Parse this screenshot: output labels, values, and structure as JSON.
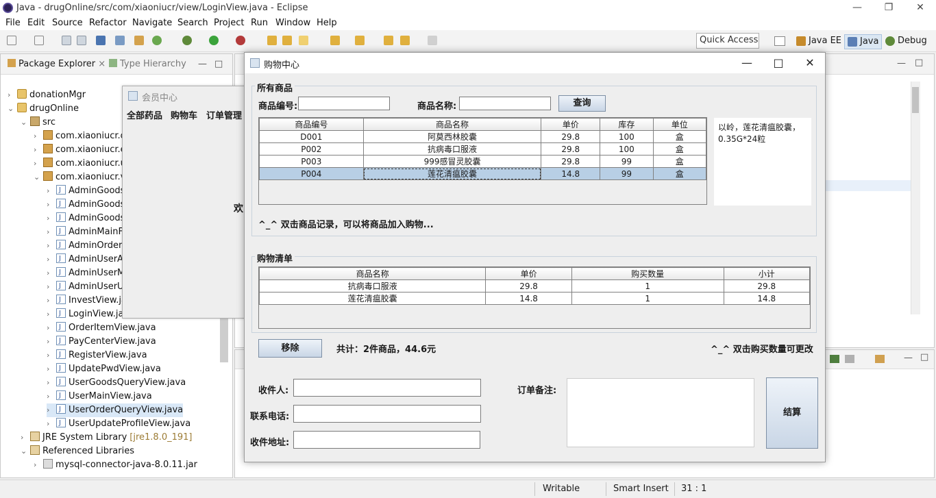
{
  "window": {
    "title": "Java - drugOnline/src/com/xiaoniucr/view/LoginView.java - Eclipse"
  },
  "menu": [
    "File",
    "Edit",
    "Source",
    "Refactor",
    "Navigate",
    "Search",
    "Project",
    "Run",
    "Window",
    "Help"
  ],
  "quick_access": "Quick Access",
  "perspectives": [
    "Java EE",
    "Java",
    "Debug"
  ],
  "package_explorer": {
    "tabs": [
      "Package Explorer",
      "Type Hierarchy"
    ],
    "tree": [
      {
        "label": "donationMgr",
        "depth": 0,
        "arrow": "›",
        "icon": "project"
      },
      {
        "label": "drugOnline",
        "depth": 0,
        "arrow": "⌄",
        "icon": "project"
      },
      {
        "label": "src",
        "depth": 1,
        "arrow": "⌄",
        "icon": "src"
      },
      {
        "label": "com.xiaoniucr.d",
        "depth": 2,
        "arrow": "›",
        "icon": "package"
      },
      {
        "label": "com.xiaoniucr.e",
        "depth": 2,
        "arrow": "›",
        "icon": "package"
      },
      {
        "label": "com.xiaoniucr.u",
        "depth": 2,
        "arrow": "›",
        "icon": "package"
      },
      {
        "label": "com.xiaoniucr.vi",
        "depth": 2,
        "arrow": "⌄",
        "icon": "package"
      },
      {
        "label": "AdminGoods",
        "depth": 3,
        "arrow": "›",
        "icon": "java"
      },
      {
        "label": "AdminGoods",
        "depth": 3,
        "arrow": "›",
        "icon": "java"
      },
      {
        "label": "AdminGoods",
        "depth": 3,
        "arrow": "›",
        "icon": "java"
      },
      {
        "label": "AdminMainF",
        "depth": 3,
        "arrow": "›",
        "icon": "java"
      },
      {
        "label": "AdminOrder",
        "depth": 3,
        "arrow": "›",
        "icon": "java"
      },
      {
        "label": "AdminUserA",
        "depth": 3,
        "arrow": "›",
        "icon": "java"
      },
      {
        "label": "AdminUserM",
        "depth": 3,
        "arrow": "›",
        "icon": "java"
      },
      {
        "label": "AdminUserU",
        "depth": 3,
        "arrow": "›",
        "icon": "java"
      },
      {
        "label": "InvestView.ja",
        "depth": 3,
        "arrow": "›",
        "icon": "java"
      },
      {
        "label": "LoginView.ja",
        "depth": 3,
        "arrow": "›",
        "icon": "java"
      },
      {
        "label": "OrderItemView.java",
        "depth": 3,
        "arrow": "›",
        "icon": "java"
      },
      {
        "label": "PayCenterView.java",
        "depth": 3,
        "arrow": "›",
        "icon": "java"
      },
      {
        "label": "RegisterView.java",
        "depth": 3,
        "arrow": "›",
        "icon": "java"
      },
      {
        "label": "UpdatePwdView.java",
        "depth": 3,
        "arrow": "›",
        "icon": "java"
      },
      {
        "label": "UserGoodsQueryView.java",
        "depth": 3,
        "arrow": "›",
        "icon": "java"
      },
      {
        "label": "UserMainView.java",
        "depth": 3,
        "arrow": "›",
        "icon": "java"
      },
      {
        "label": "UserOrderQueryView.java",
        "depth": 3,
        "arrow": "›",
        "icon": "java",
        "selected": true
      },
      {
        "label": "UserUpdateProfileView.java",
        "depth": 3,
        "arrow": "›",
        "icon": "java"
      },
      {
        "label": "JRE System Library",
        "suffix": "[jre1.8.0_191]",
        "depth": 1,
        "arrow": "›",
        "icon": "lib"
      },
      {
        "label": "Referenced Libraries",
        "depth": 1,
        "arrow": "⌄",
        "icon": "lib"
      },
      {
        "label": "mysql-connector-java-8.0.11.jar",
        "depth": 2,
        "arrow": "›",
        "icon": "jar"
      }
    ]
  },
  "member_window": {
    "title": "会员中心",
    "menu": [
      "全部药品",
      "购物车",
      "订单管理"
    ],
    "welcome": "欢"
  },
  "dialog": {
    "title": "购物中心",
    "all_goods": {
      "label": "所有商品",
      "code_label": "商品编号:",
      "name_label": "商品名称:",
      "code_value": "",
      "name_value": "",
      "query_button": "查询",
      "columns": [
        "商品编号",
        "商品名称",
        "单价",
        "库存",
        "单位"
      ],
      "rows": [
        [
          "D001",
          "阿莫西林胶囊",
          "29.8",
          "100",
          "盒"
        ],
        [
          "P002",
          "抗病毒口服液",
          "29.8",
          "100",
          "盒"
        ],
        [
          "P003",
          "999感冒灵胶囊",
          "29.8",
          "99",
          "盒"
        ],
        [
          "P004",
          "莲花清瘟胶囊",
          "14.8",
          "99",
          "盒"
        ]
      ],
      "selected_row": 3,
      "description": "以岭，莲花清瘟胶囊，0.35G*24粒",
      "hint": "^_^ 双击商品记录，可以将商品加入购物..."
    },
    "cart": {
      "label": "购物清单",
      "columns": [
        "商品名称",
        "单价",
        "购买数量",
        "小计"
      ],
      "rows": [
        [
          "抗病毒口服液",
          "29.8",
          "1",
          "29.8"
        ],
        [
          "莲花清瘟胶囊",
          "14.8",
          "1",
          "14.8"
        ]
      ],
      "remove_button": "移除",
      "total": "共计：2件商品，44.6元",
      "hint": "^_^ 双击购买数量可更改"
    },
    "order": {
      "receiver_label": "收件人:",
      "phone_label": "联系电话:",
      "address_label": "收件地址:",
      "remark_label": "订单备注:",
      "receiver_value": "",
      "phone_value": "",
      "address_value": "",
      "remark_value": "",
      "checkout_button": "结算"
    }
  },
  "status": {
    "writable": "Writable",
    "insert_mode": "Smart Insert",
    "position": "31 : 1"
  },
  "colors": {
    "selection": "#b8cfe5",
    "button_border": "#7c8ea4",
    "tree_selection": "#d9e8f7"
  }
}
